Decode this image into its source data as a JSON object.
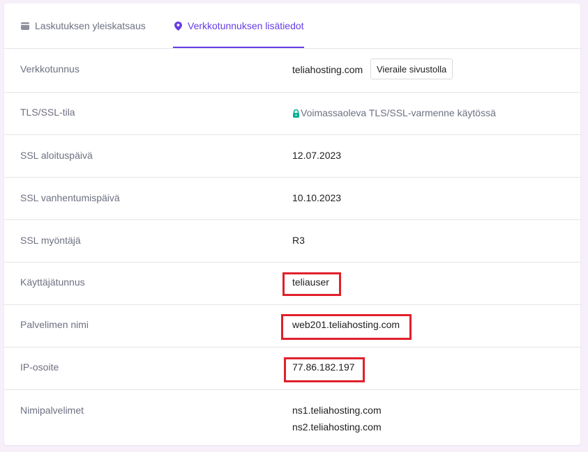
{
  "tabs": [
    {
      "label": "Laskutuksen yleiskatsaus",
      "active": false,
      "icon": "billing-icon"
    },
    {
      "label": "Verkkotunnuksen lisätiedot",
      "active": true,
      "icon": "location-pin-icon"
    }
  ],
  "rows": {
    "domain": {
      "label": "Verkkotunnus",
      "value": "teliahosting.com",
      "button": "Vieraile sivustolla"
    },
    "tls": {
      "label": "TLS/SSL-tila",
      "value": "Voimassaoleva TLS/SSL-varmenne käytössä",
      "icon": "lock-icon"
    },
    "ssl_start": {
      "label": "SSL aloituspäivä",
      "value": "12.07.2023"
    },
    "ssl_expiry": {
      "label": "SSL vanhentumispäivä",
      "value": "10.10.2023"
    },
    "ssl_issuer": {
      "label": "SSL myöntäjä",
      "value": "R3"
    },
    "username": {
      "label": "Käyttäjätunnus",
      "value": "teliauser"
    },
    "server": {
      "label": "Palvelimen nimi",
      "value": "web201.teliahosting.com"
    },
    "ip": {
      "label": "IP-osoite",
      "value": "77.86.182.197"
    },
    "nameservers": {
      "label": "Nimipalvelimet",
      "values": [
        "ns1.teliahosting.com",
        "ns2.teliahosting.com"
      ]
    }
  },
  "colors": {
    "accent": "#673de6",
    "highlight": "#e0202b",
    "ssl_ok": "#00b090"
  }
}
